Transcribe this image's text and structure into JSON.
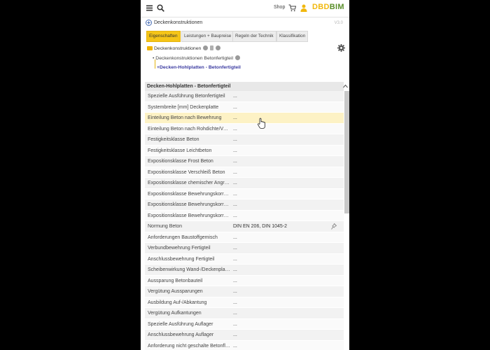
{
  "topbar": {
    "shop_label": "Shop",
    "logo_part1": "DBD",
    "logo_part2": "BIM"
  },
  "title": {
    "text": "Deckenkonstruktionen",
    "version": "V3.0"
  },
  "tabs": [
    {
      "label": "Eigenschaften",
      "active": true
    },
    {
      "label": "Leistungen + Baupreise",
      "active": false
    },
    {
      "label": "Regeln der Technik",
      "active": false
    },
    {
      "label": "Klassifikation",
      "active": false
    }
  ],
  "tree": {
    "root": "Deckenkonstruktionen",
    "child": "Deckenkonstruktionen Betonfertigteil",
    "selected": "Decken-Hohlplatten - Betonfertigteil"
  },
  "section": {
    "title": "Decken-Hohlplatten - Betonfertigteil"
  },
  "rows": [
    {
      "label": "Spezielle Ausführung Betonfertigteil",
      "value": "..."
    },
    {
      "label": "Systembreite [mm] Deckenplatte",
      "value": "..."
    },
    {
      "label": "Einteilung Beton nach Bewehrung",
      "value": "...",
      "highlight": true
    },
    {
      "label": "Einteilung Beton nach Rohdichte/Verwen...",
      "value": "..."
    },
    {
      "label": "Festigkeitsklasse Beton",
      "value": "..."
    },
    {
      "label": "Festigkeitsklasse Leichtbeton",
      "value": "..."
    },
    {
      "label": "Expositionsklasse Frost Beton",
      "value": "..."
    },
    {
      "label": "Expositionsklasse Verschleiß Beton",
      "value": "..."
    },
    {
      "label": "Expositionsklasse chemischer Angriff Beton",
      "value": "..."
    },
    {
      "label": "Expositionsklasse Bewehrungskorrosion...",
      "value": "..."
    },
    {
      "label": "Expositionsklasse Bewehrungskorrosion...",
      "value": "..."
    },
    {
      "label": "Expositionsklasse Bewehrungskorrosion...",
      "value": "..."
    },
    {
      "label": "Normung Beton",
      "value": "DIN EN 206, DIN 1045-2",
      "pin": true
    },
    {
      "label": "Anforderungen Baustoffgemisch",
      "value": "..."
    },
    {
      "label": "Verbundbewehrung Fertigteil",
      "value": "..."
    },
    {
      "label": "Anschlussbewehrung Fertigteil",
      "value": "..."
    },
    {
      "label": "Scheibenwirkung Wand-/Deckenplatte",
      "value": "..."
    },
    {
      "label": "Aussparung Betonbauteil",
      "value": "..."
    },
    {
      "label": "Vergütung Aussparungen",
      "value": "..."
    },
    {
      "label": "Ausbildung Auf-/Abkantung",
      "value": "..."
    },
    {
      "label": "Vergütung Aufkantungen",
      "value": "..."
    },
    {
      "label": "Spezielle Ausführung Auflager",
      "value": "..."
    },
    {
      "label": "Anschlussbewehrung Auflager",
      "value": "..."
    },
    {
      "label": "Anforderung nicht geschalte Betonfläche",
      "value": "..."
    }
  ]
}
